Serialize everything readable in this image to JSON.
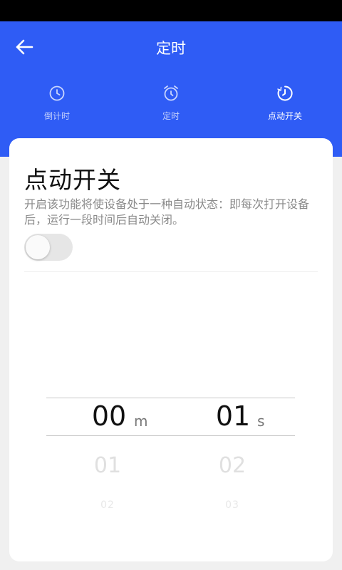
{
  "header": {
    "title": "定时"
  },
  "tabs": [
    {
      "label": "倒计时",
      "icon": "clock-icon",
      "active": false
    },
    {
      "label": "定时",
      "icon": "alarm-clock-icon",
      "active": false
    },
    {
      "label": "点动开关",
      "icon": "timer-icon",
      "active": true
    }
  ],
  "card": {
    "title": "点动开关",
    "description": "开启该功能将使设备处于一种自动状态：即每次打开设备后，运行一段时间后自动关闭。",
    "toggle_on": false
  },
  "picker": {
    "minutes": {
      "selected": "00",
      "unit": "m",
      "next": "01",
      "next2": "02"
    },
    "seconds": {
      "selected": "01",
      "unit": "s",
      "next": "02",
      "next2": "03"
    }
  },
  "colors": {
    "primary": "#2f5cf5",
    "card_background": "#ffffff",
    "page_background": "#f0f0f0"
  }
}
